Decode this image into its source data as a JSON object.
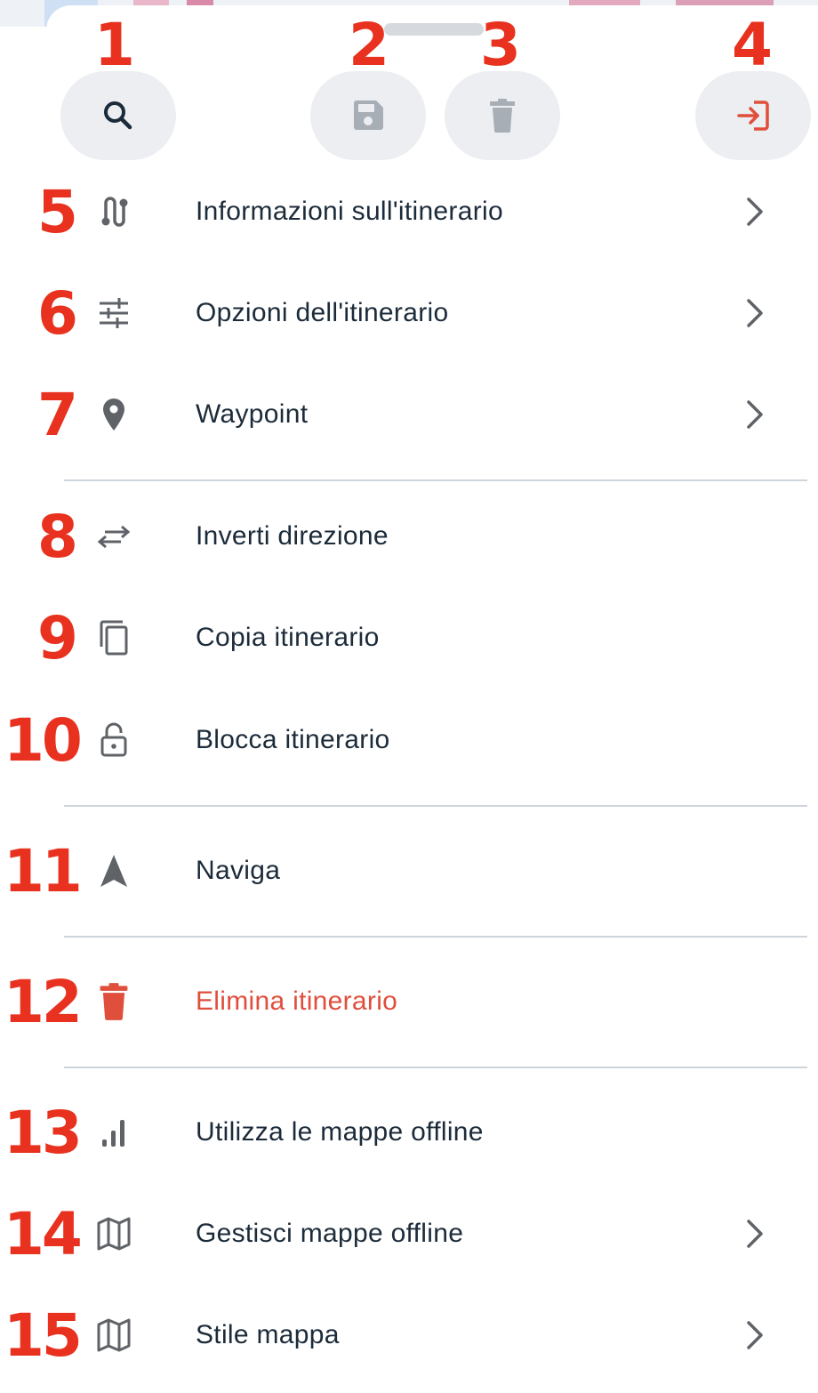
{
  "toolbar": {
    "search": {
      "badge": "1",
      "icon": "search-icon"
    },
    "save": {
      "badge": "2",
      "icon": "save-icon"
    },
    "delete": {
      "badge": "3",
      "icon": "trash-icon"
    },
    "exit": {
      "badge": "4",
      "icon": "exit-icon"
    }
  },
  "colors": {
    "text": "#1c2b3a",
    "icon": "#5f6368",
    "danger": "#e04e3c",
    "badge": "#e8321f",
    "button_bg": "#eceef1",
    "divider": "#cfd5dc"
  },
  "menu": {
    "items": [
      {
        "badge": "5",
        "icon": "route-icon",
        "label": "Informazioni sull'itinerario",
        "chevron": true
      },
      {
        "badge": "6",
        "icon": "sliders-icon",
        "label": "Opzioni dell'itinerario",
        "chevron": true
      },
      {
        "badge": "7",
        "icon": "map-pin-icon",
        "label": "Waypoint",
        "chevron": true
      },
      {
        "badge": "8",
        "icon": "swap-icon",
        "label": "Inverti direzione",
        "chevron": false
      },
      {
        "badge": "9",
        "icon": "copy-icon",
        "label": "Copia itinerario",
        "chevron": false
      },
      {
        "badge": "10",
        "icon": "unlock-icon",
        "label": "Blocca itinerario",
        "chevron": false
      },
      {
        "badge": "11",
        "icon": "navigation-arrow-icon",
        "label": "Naviga",
        "chevron": false
      },
      {
        "badge": "12",
        "icon": "trash-icon",
        "label": "Elimina itinerario",
        "chevron": false
      },
      {
        "badge": "13",
        "icon": "signal-bars-icon",
        "label": "Utilizza le mappe offline",
        "chevron": false
      },
      {
        "badge": "14",
        "icon": "map-icon",
        "label": "Gestisci mappe offline",
        "chevron": true
      },
      {
        "badge": "15",
        "icon": "map-icon",
        "label": "Stile mappa",
        "chevron": true
      }
    ]
  }
}
